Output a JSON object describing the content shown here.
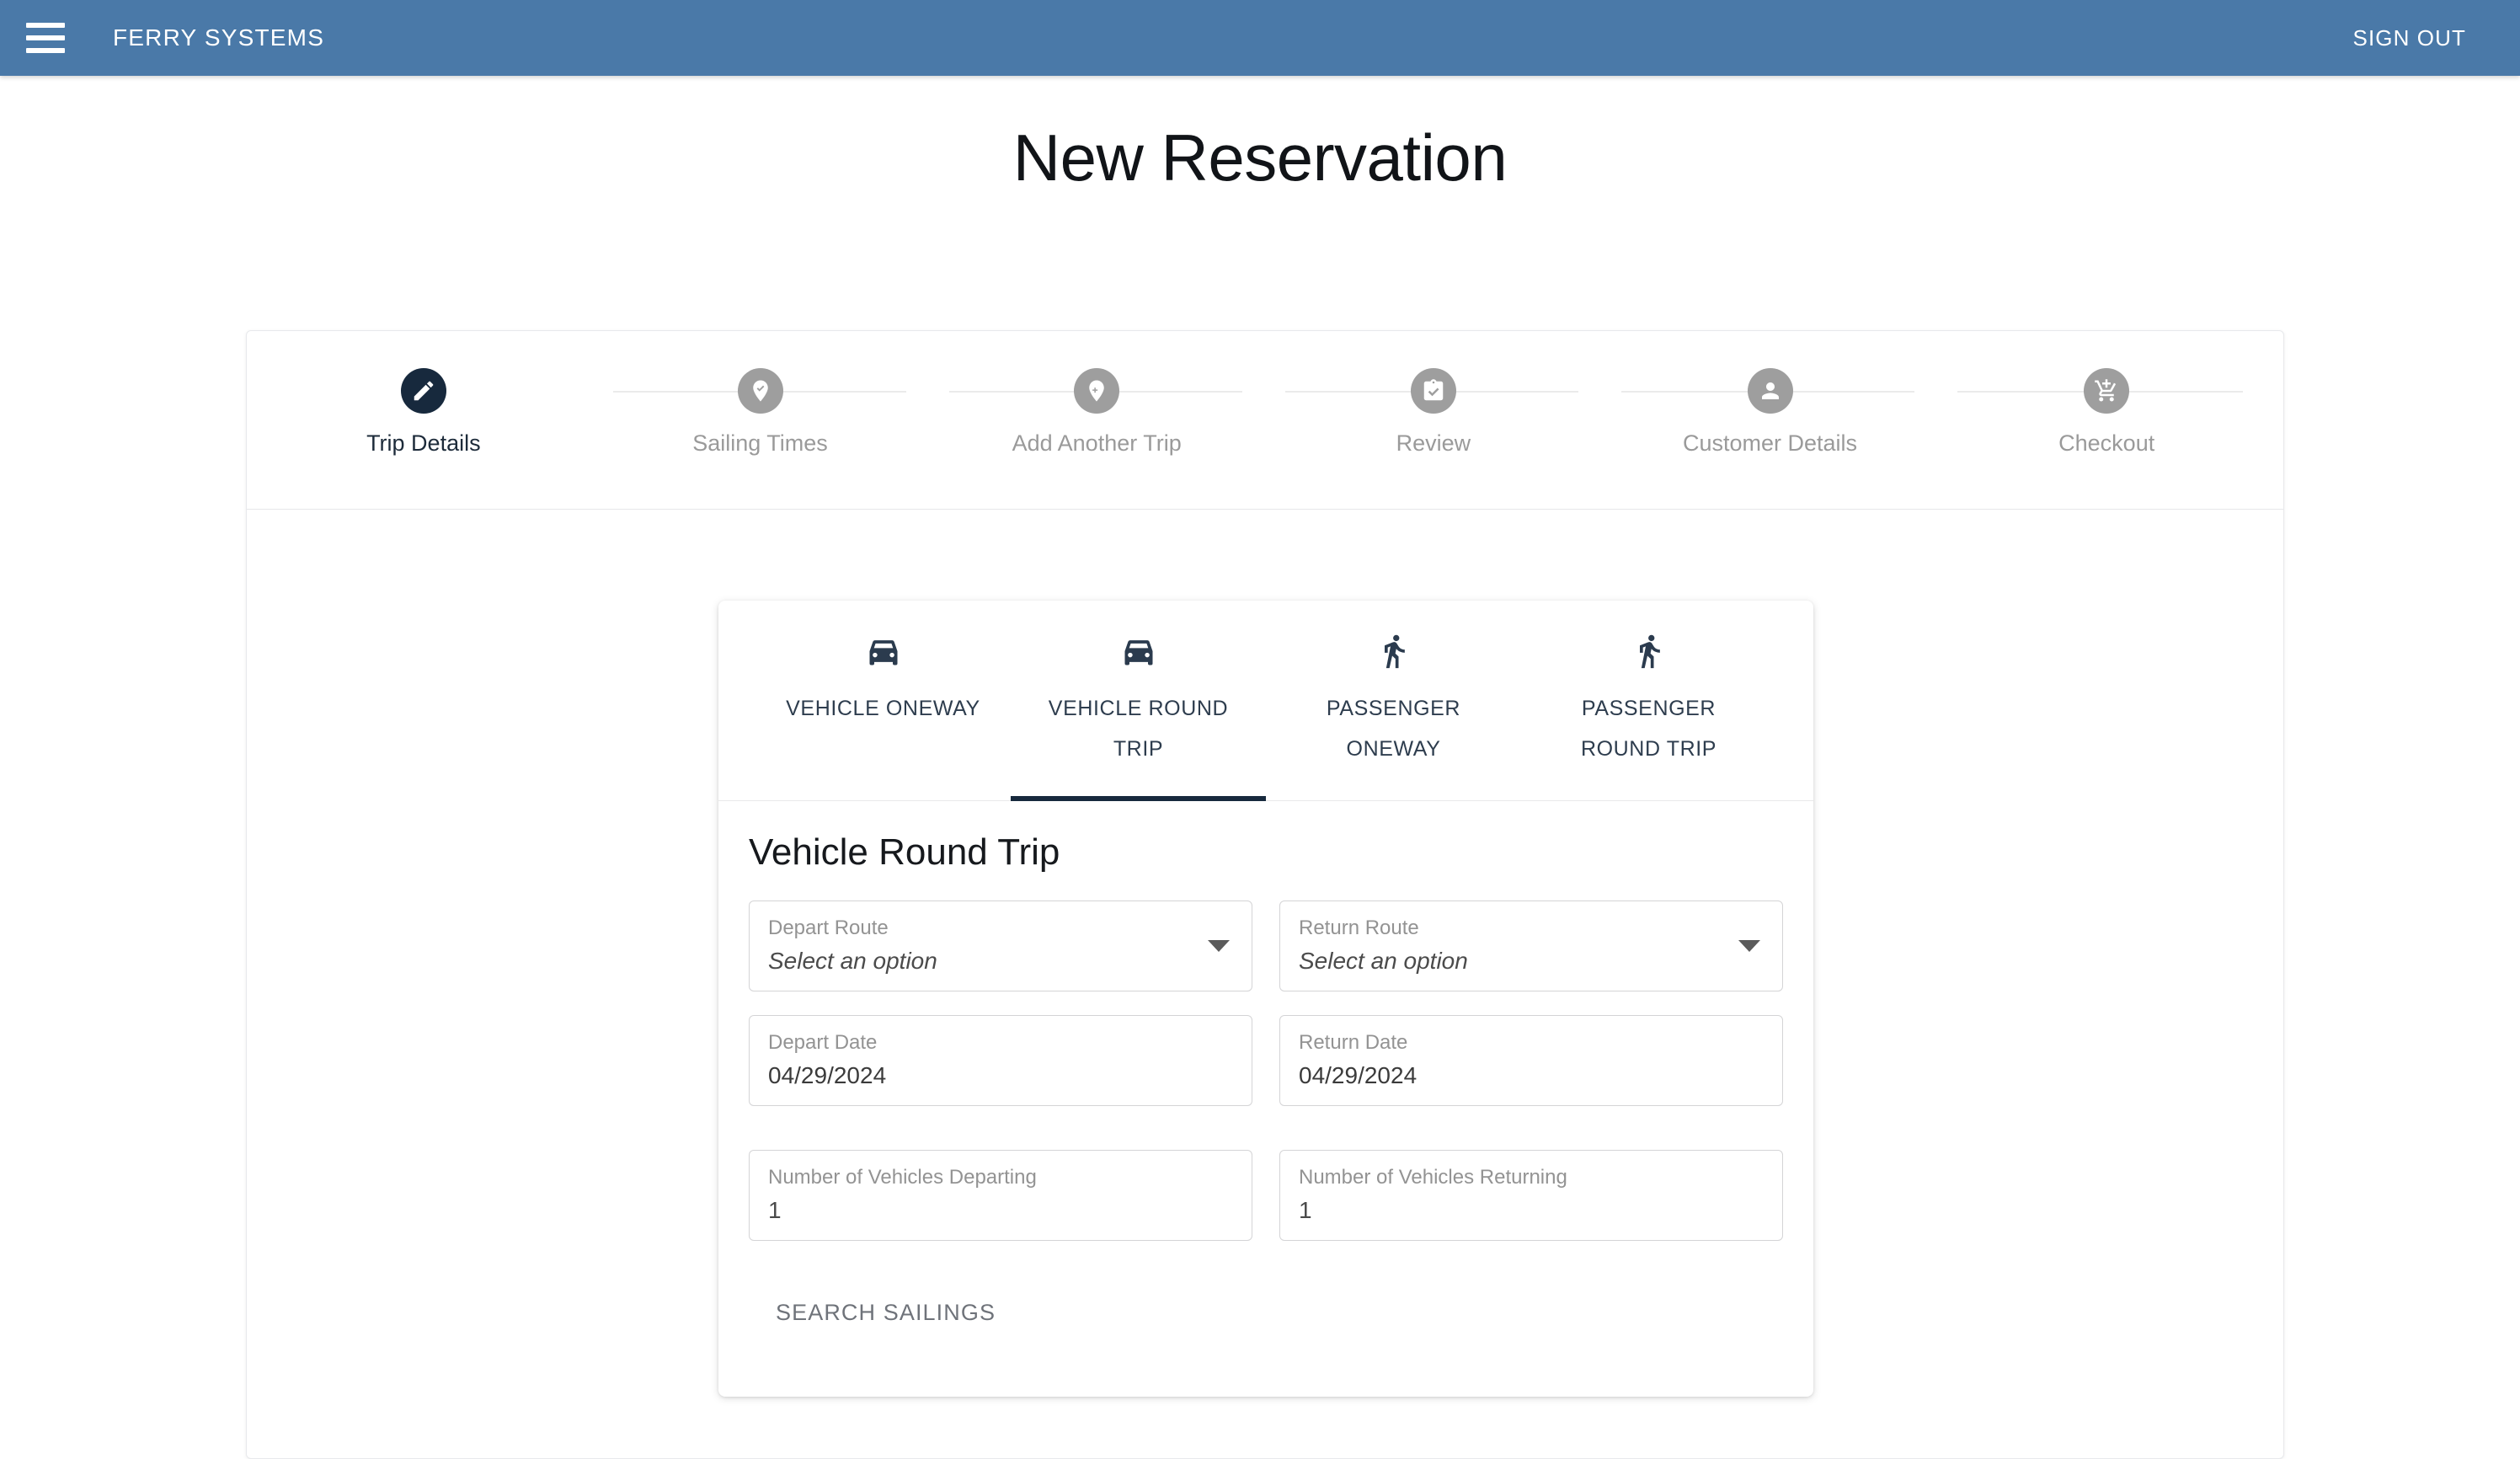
{
  "appbar": {
    "menu_icon": "hamburger-menu-icon",
    "brand": "FERRY SYSTEMS",
    "signout_label": "SIGN OUT",
    "background": "#4a79a8"
  },
  "page": {
    "title": "New Reservation",
    "accent": "#17293d"
  },
  "stepper": {
    "active_index": 0,
    "steps": [
      {
        "label": "Trip Details",
        "icon": "pencil-icon",
        "state": "active"
      },
      {
        "label": "Sailing Times",
        "icon": "location-check-icon",
        "state": "inactive"
      },
      {
        "label": "Add Another Trip",
        "icon": "location-add-icon",
        "state": "inactive"
      },
      {
        "label": "Review",
        "icon": "clipboard-check-icon",
        "state": "inactive"
      },
      {
        "label": "Customer Details",
        "icon": "person-icon",
        "state": "inactive"
      },
      {
        "label": "Checkout",
        "icon": "add-shopping-cart-icon",
        "state": "inactive"
      }
    ]
  },
  "tabs": {
    "active_index": 1,
    "items": [
      {
        "label": "VEHICLE ONEWAY",
        "icon": "car-icon"
      },
      {
        "label": "VEHICLE ROUND TRIP",
        "icon": "car-icon"
      },
      {
        "label": "PASSENGER ONEWAY",
        "icon": "walking-person-icon"
      },
      {
        "label": "PASSENGER ROUND TRIP",
        "icon": "walking-person-icon"
      }
    ]
  },
  "form": {
    "heading": "Vehicle Round Trip",
    "depart_route": {
      "label": "Depart Route",
      "value": "Select an option"
    },
    "return_route": {
      "label": "Return Route",
      "value": "Select an option"
    },
    "depart_date": {
      "label": "Depart Date",
      "value": "04/29/2024"
    },
    "return_date": {
      "label": "Return Date",
      "value": "04/29/2024"
    },
    "vehicles_departing": {
      "label": "Number of Vehicles Departing",
      "value": "1"
    },
    "vehicles_returning": {
      "label": "Number of Vehicles Returning",
      "value": "1"
    },
    "search_label": "SEARCH SAILINGS"
  }
}
